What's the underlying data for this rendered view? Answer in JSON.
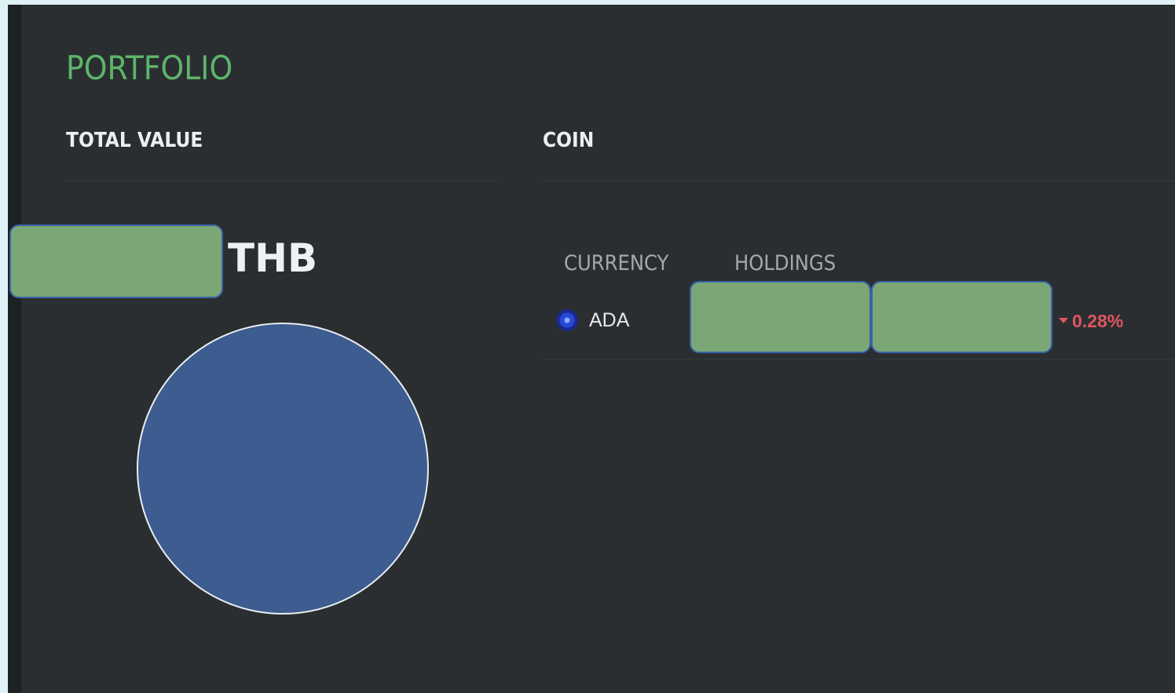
{
  "page": {
    "title": "PORTFOLIO"
  },
  "total_value": {
    "heading": "TOTAL VALUE",
    "currency": "THB",
    "amount_redacted": true
  },
  "coins": {
    "heading": "COIN",
    "columns": [
      "CURRENCY",
      "HOLDINGS"
    ],
    "rows": [
      {
        "symbol": "ADA",
        "icon": "cardano-icon",
        "holdings_redacted": true,
        "value_redacted": true,
        "change": "0.28%",
        "change_direction": "down"
      }
    ]
  },
  "chart_data": {
    "type": "pie",
    "categories": [
      "ADA"
    ],
    "values": [
      100
    ],
    "colors": [
      "#3d5c8f"
    ]
  },
  "colors": {
    "background": "#2a2e31",
    "title": "#5db56a",
    "negative_change": "#e0565e",
    "pie_fill": "#3d5c8f",
    "redaction_fill": "#7ba776",
    "redaction_border": "#3a63a8"
  }
}
